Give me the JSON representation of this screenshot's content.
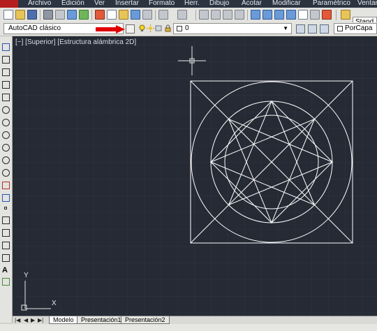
{
  "menu": {
    "items": [
      "Archivo",
      "Edición",
      "Ver",
      "Insertar",
      "Formato",
      "Herr.",
      "Dibujo",
      "Acotar",
      "Modificar",
      "Paramétrico",
      "Ventan"
    ]
  },
  "toolbar": {
    "standard_label": "Stand",
    "workspace": "AutoCAD clásico",
    "layer": "0",
    "color": "PorCapa"
  },
  "viewport": {
    "label": "[−] [Superior] [Estructura alámbrica 2D]",
    "ucs_x": "X",
    "ucs_y": "Y"
  },
  "tabs": [
    "Modelo",
    "Presentación1",
    "Presentación2"
  ],
  "colors": {
    "canvas": "#252a34",
    "grid": "#2e3442",
    "geometry": "#ffffff",
    "arrow": "#e00000"
  }
}
